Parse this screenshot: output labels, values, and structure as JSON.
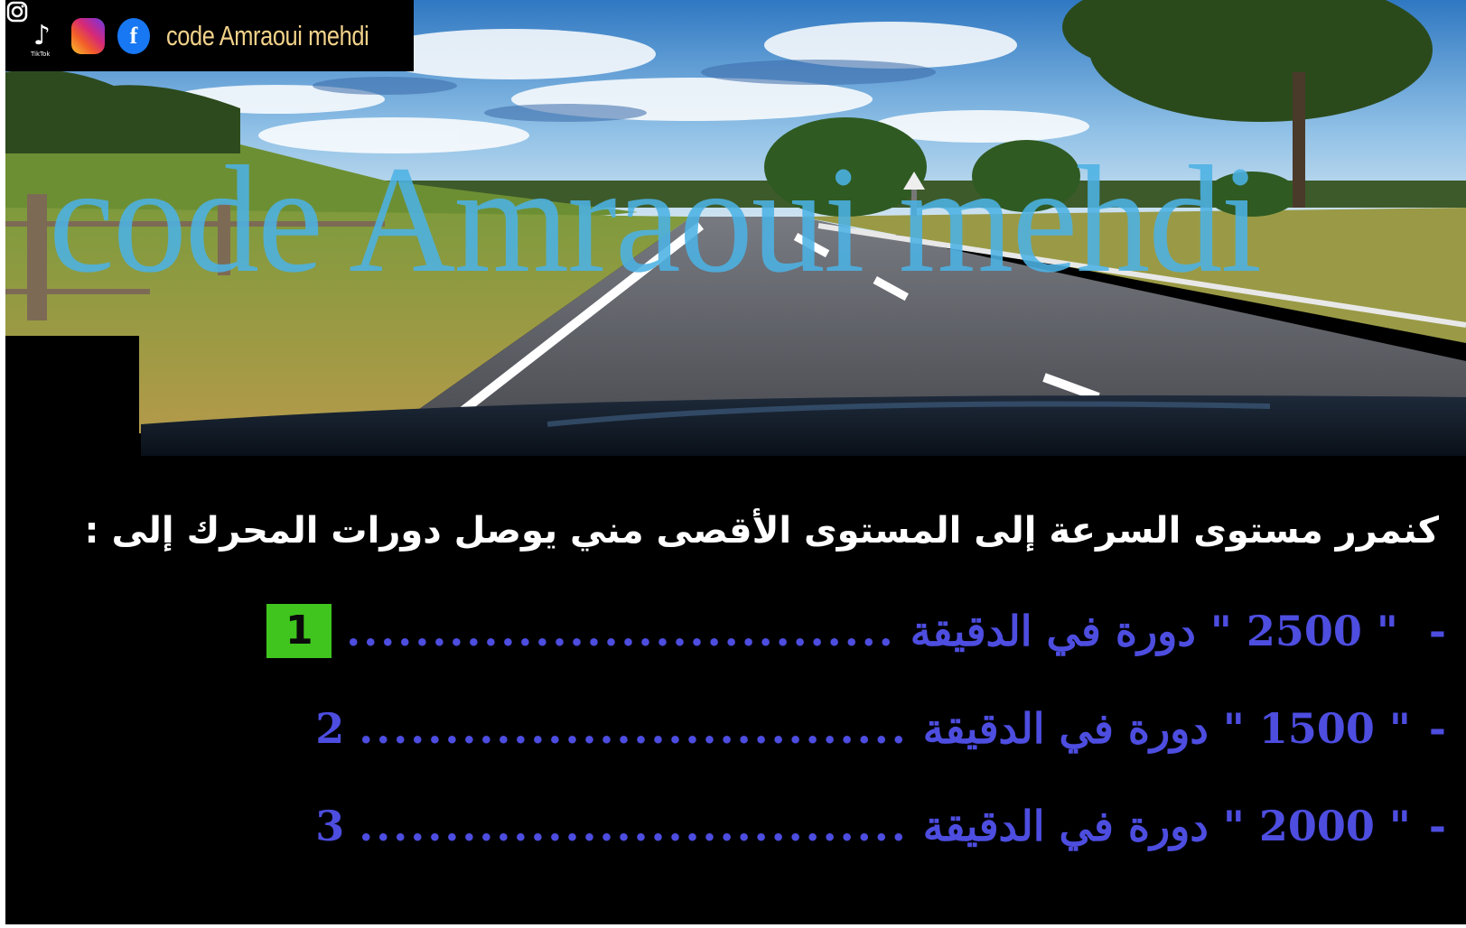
{
  "social": {
    "tiktok_label": "TikTok",
    "handle": "code Amraoui mehdi"
  },
  "watermark": "code Amraoui mehdi",
  "question": {
    "text": "كنمرر مستوى السرعة إلى المستوى الأقصى مني يوصل  دورات المحرك إلى :"
  },
  "answers": [
    {
      "dash": "-",
      "text": "\" 2500 \" دورة في الدقيقة",
      "dots": "................................",
      "number": "1",
      "selected": true
    },
    {
      "dash": "-",
      "text": "\" 1500 \" دورة في الدقيقة",
      "dots": "................................",
      "number": "2",
      "selected": false
    },
    {
      "dash": "-",
      "text": "\" 2000 \" دورة في الدقيقة",
      "dots": "................................",
      "number": "3",
      "selected": false
    }
  ],
  "colors": {
    "answer_text": "#4d4de0",
    "selected_badge": "#3fc51e",
    "watermark": "#4cb2e4",
    "question_text": "#ffffff"
  }
}
